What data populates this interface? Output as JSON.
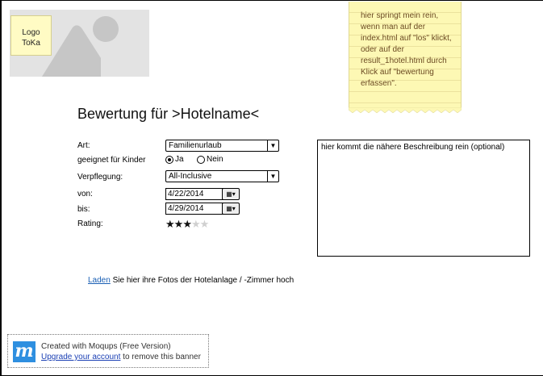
{
  "logo": {
    "line1": "Logo",
    "line2": "ToKa"
  },
  "sticky_note": {
    "lines": [
      "hier springt mein rein,",
      "wenn man auf der",
      "index.html auf \"los\" klickt,",
      "oder auf der",
      "result_1hotel.html durch",
      "Klick auf \"bewertung",
      "erfassen\"."
    ]
  },
  "form": {
    "title": "Bewertung für >Hotelname<",
    "art": {
      "label": "Art:",
      "value": "Familienurlaub"
    },
    "kinder": {
      "label": "geeignet für Kinder",
      "yes": "Ja",
      "no": "Nein",
      "selected": "Ja"
    },
    "verpflegung": {
      "label": "Verpflegung:",
      "value": "All-Inclusive"
    },
    "von": {
      "label": "von:",
      "value": "4/22/2014"
    },
    "bis": {
      "label": "bis:",
      "value": "4/29/2014"
    },
    "rating": {
      "label": "Rating:",
      "value": 3,
      "max": 5
    },
    "description": "hier kommt die nähere Beschreibung rein (optional)"
  },
  "upload": {
    "link": "Laden",
    "text": " Sie hier ihre Fotos der Hotelanlage / -Zimmer hoch"
  },
  "banner": {
    "line1": "Created with Moqups (Free Version)",
    "upgrade_link": "Upgrade your account",
    "line2_rest": " to remove this banner",
    "logo_letter": "m"
  }
}
